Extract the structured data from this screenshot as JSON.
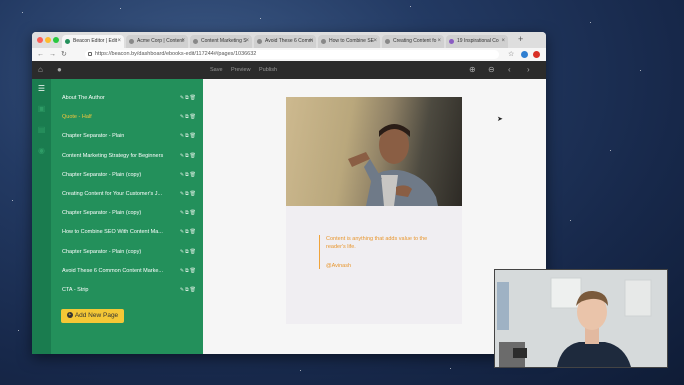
{
  "browser": {
    "tabs": [
      {
        "label": "Beacon Editor | Edit"
      },
      {
        "label": "Acme Corp | Content"
      },
      {
        "label": "Content Marketing S"
      },
      {
        "label": "Avoid These 6 Comm"
      },
      {
        "label": "How to Combine SE"
      },
      {
        "label": "Creating Content fo"
      },
      {
        "label": "19 Inspirational Co"
      }
    ],
    "url": "https://beacon.by/dashboard/ebooks-edit/117244#/pages/1036632"
  },
  "toolbar": {
    "save": "Save",
    "preview": "Preview",
    "publish": "Publish"
  },
  "sidebar": {
    "items": [
      {
        "label": "About The Author"
      },
      {
        "label": "Quote - Half"
      },
      {
        "label": "Chapter Separator - Plain"
      },
      {
        "label": "Content Marketing Strategy for Beginners"
      },
      {
        "label": "Chapter Separator - Plain (copy)"
      },
      {
        "label": "Creating Content for Your Customer's J..."
      },
      {
        "label": "Chapter Separator - Plain (copy)"
      },
      {
        "label": "How to Combine SEO With Content Ma..."
      },
      {
        "label": "Chapter Separator - Plain (copy)"
      },
      {
        "label": "Avoid These 6 Common Content Marke..."
      },
      {
        "label": "CTA - Strip"
      }
    ],
    "active_index": 1,
    "add_button": "Add New Page"
  },
  "page": {
    "quote_text": "Content is anything that adds value to the reader's life.",
    "quote_author": "@Avinash"
  },
  "colors": {
    "sidebar": "#23905b",
    "accent": "#f4c736",
    "quote": "#e8962e"
  }
}
